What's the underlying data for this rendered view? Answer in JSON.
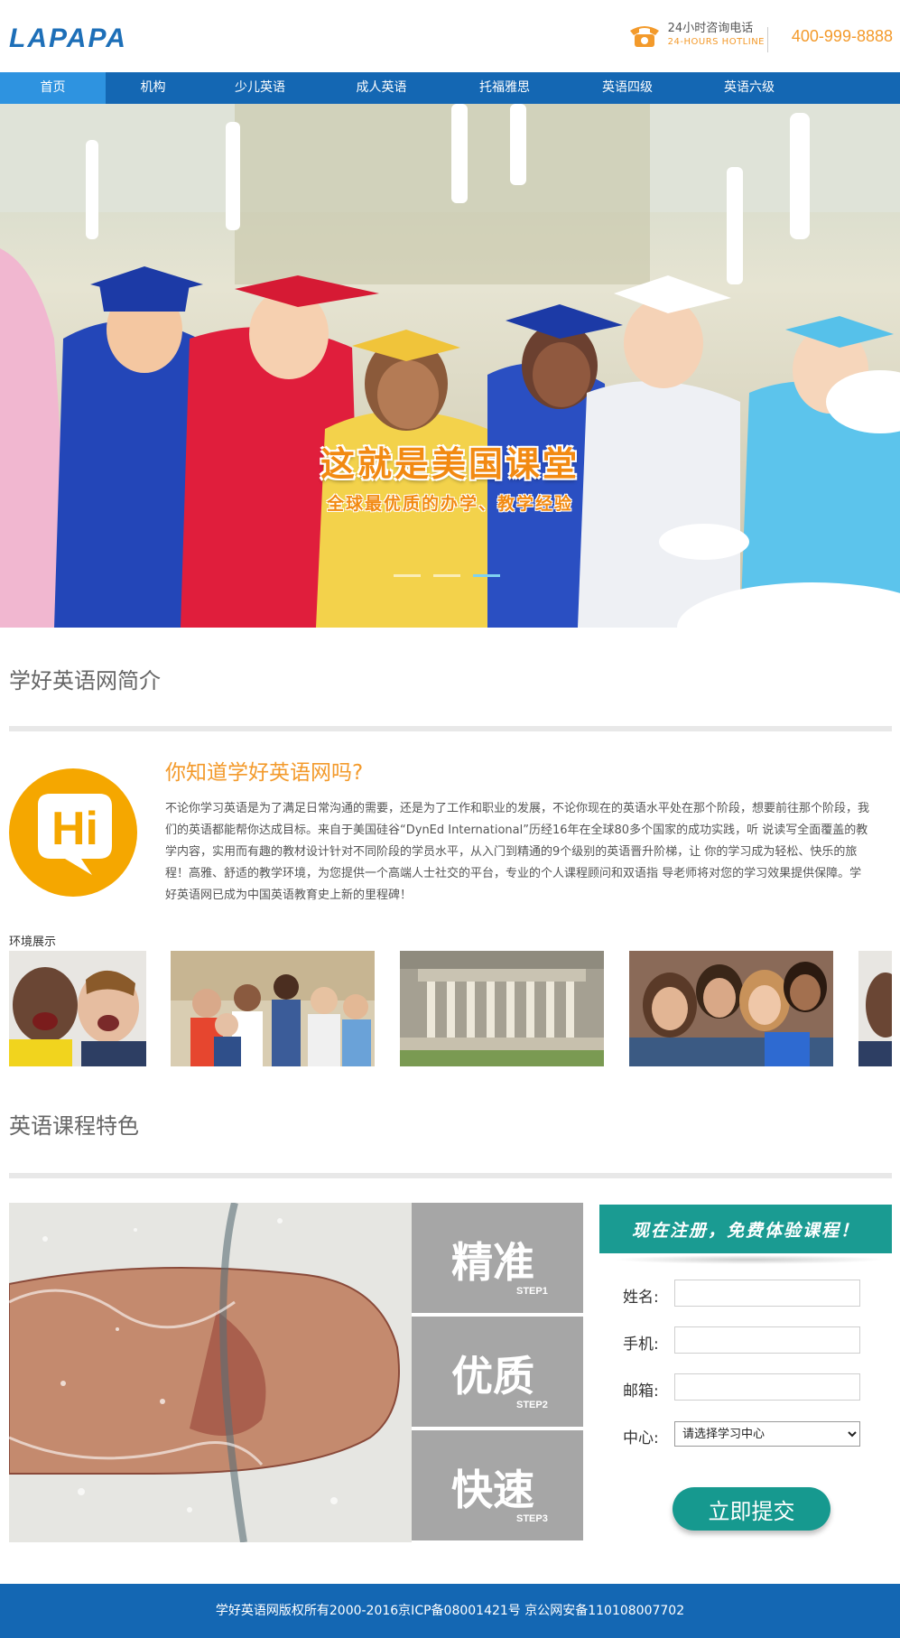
{
  "header": {
    "logo": "LAPAPA",
    "hotline_cn": "24小时咨询电话",
    "hotline_en": "24-HOURS  HOTLINE",
    "hotline_number": "400-999-8888"
  },
  "nav": {
    "items": [
      {
        "label": "首页",
        "active": true
      },
      {
        "label": "机构",
        "active": false
      },
      {
        "label": "少儿英语",
        "active": false
      },
      {
        "label": "成人英语",
        "active": false
      },
      {
        "label": "托福雅思",
        "active": false
      },
      {
        "label": "英语四级",
        "active": false
      },
      {
        "label": "英语六级",
        "active": false
      }
    ]
  },
  "hero": {
    "title": "这就是美国课堂",
    "subtitle": "全球最优质的办学、教学经验",
    "slide_count": 3,
    "active_slide": 3
  },
  "intro": {
    "section_title": "学好英语网简介",
    "badge_text": "Hi",
    "heading": "你知道学好英语网吗?",
    "body": "不论你学习英语是为了满足日常沟通的需要，还是为了工作和职业的发展，不论你现在的英语水平处在那个阶段，想要前往那个阶段，我们的英语都能帮你达成目标。来自于美国硅谷“DynEd International”历经16年在全球80多个国家的成功实践，听 说读写全面覆盖的教学内容，实用而有趣的教材设计针对不同阶段的学员水平，从入门到精通的9个级别的英语晋升阶梯，让 你的学习成为轻松、快乐的旅程！高雅、舒适的教学环境，为您提供一个高端人士社交的平台，专业的个人课程顾问和双语指 导老师将对您的学习效果提供保障。学好英语网已成为中国英语教育史上新的里程碑！"
  },
  "environment": {
    "label": "环境展示"
  },
  "features": {
    "section_title": "英语课程特色",
    "steps": [
      {
        "cn": "精准",
        "en": "STEP1"
      },
      {
        "cn": "优质",
        "en": "STEP2"
      },
      {
        "cn": "快速",
        "en": "STEP3"
      }
    ]
  },
  "register": {
    "banner": "现在注册，免费体验课程！",
    "fields": {
      "name_label": "姓名:",
      "phone_label": "手机:",
      "email_label": "邮箱:",
      "center_label": "中心:"
    },
    "center_select_value": "请选择学习中心",
    "submit_label": "立即提交"
  },
  "footer": {
    "text": "学好英语网版权所有2000-2016京ICP备08001421号  京公网安备110108007702"
  },
  "colors": {
    "brand_blue": "#1467b3",
    "nav_active": "#2e93e0",
    "accent_orange": "#f39a2b",
    "teal": "#16998f",
    "step_gray": "#a6a6a6"
  }
}
